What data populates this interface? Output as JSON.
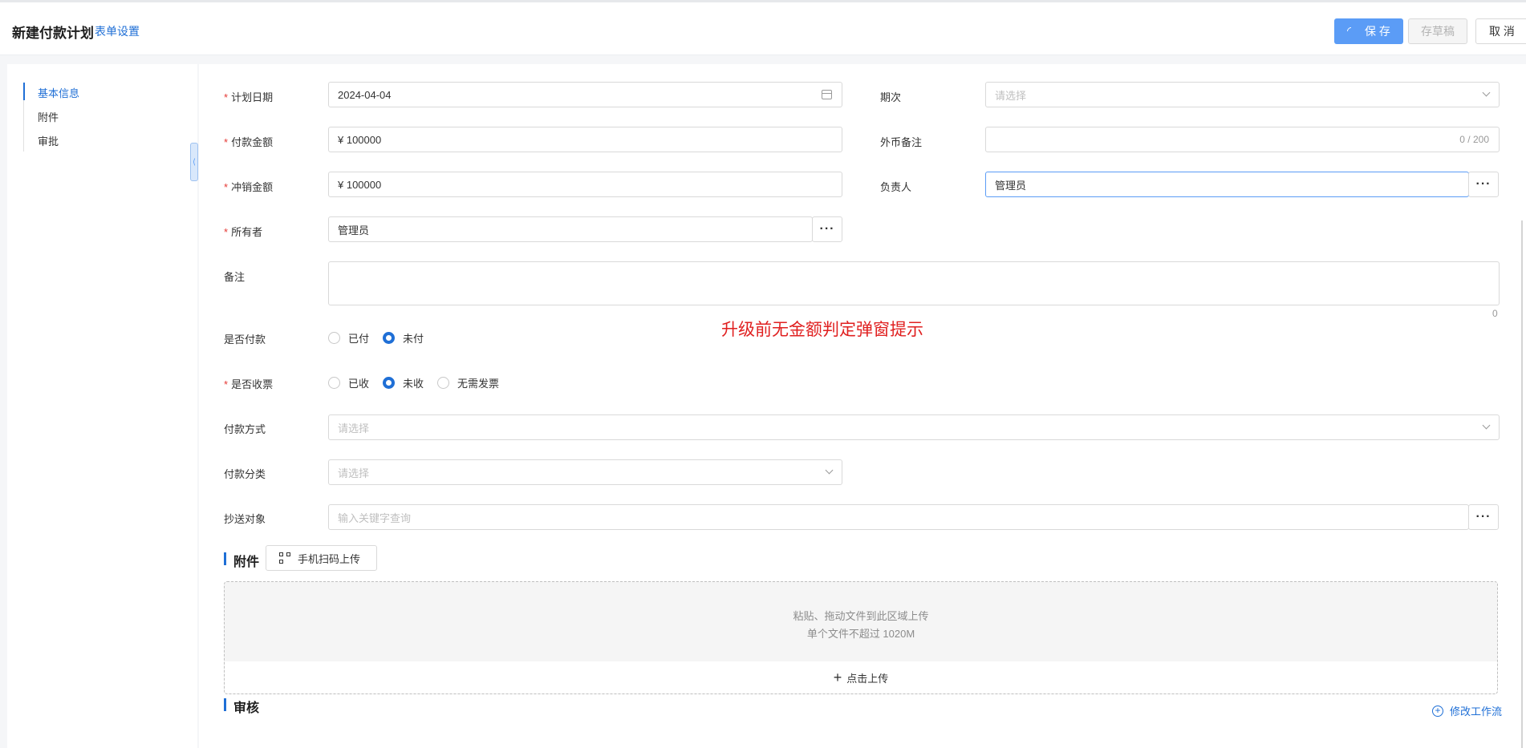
{
  "header": {
    "title": "新建付款计划",
    "form_settings": "表单设置",
    "save": "保 存",
    "draft": "存草稿",
    "cancel": "取 消"
  },
  "anchors": [
    "基本信息",
    "附件",
    "审批"
  ],
  "fields": {
    "plan_date": {
      "label": "计划日期",
      "value": "2024-04-04",
      "required": true
    },
    "period": {
      "label": "期次",
      "placeholder": "请选择"
    },
    "pay_amount": {
      "label": "付款金额",
      "value": "¥  100000",
      "required": true
    },
    "fx_note": {
      "label": "外币备注",
      "counter": "0 / 200"
    },
    "offset_amount": {
      "label": "冲销金额",
      "value": "¥  100000",
      "required": true
    },
    "owner_person": {
      "label": "负责人",
      "value": "管理员"
    },
    "owner": {
      "label": "所有者",
      "value": "管理员",
      "required": true
    },
    "remark": {
      "label": "备注",
      "counter": "0"
    },
    "is_paid": {
      "label": "是否付款",
      "options": [
        "已付",
        "未付"
      ],
      "selected": "未付"
    },
    "invoice": {
      "label": "是否收票",
      "options": [
        "已收",
        "未收",
        "无需发票"
      ],
      "selected": "未收",
      "required": true
    },
    "pay_method": {
      "label": "付款方式",
      "placeholder": "请选择"
    },
    "pay_category": {
      "label": "付款分类",
      "placeholder": "请选择"
    },
    "cc": {
      "label": "抄送对象",
      "placeholder": "输入关键字查询"
    }
  },
  "overlay_note": "升级前无金额判定弹窗提示",
  "attachments": {
    "title": "附件",
    "qr_button": "手机扫码上传",
    "drop_hint": "粘贴、拖动文件到此区域上传",
    "size_hint": "单个文件不超过 1020M",
    "upload_button": "点击上传"
  },
  "approval": {
    "title": "审核",
    "edit_workflow": "修改工作流"
  },
  "icons": [
    "loading-icon",
    "calendar-icon",
    "chevron-down-icon",
    "ellipsis-icon",
    "qrcode-icon",
    "plus-icon",
    "plus-circle-icon",
    "collapse-arrow-icon"
  ],
  "colors": {
    "accent": "#1f6fd6",
    "save_button": "#5b9cf6",
    "required": "#e53935",
    "note": "#e02020"
  }
}
